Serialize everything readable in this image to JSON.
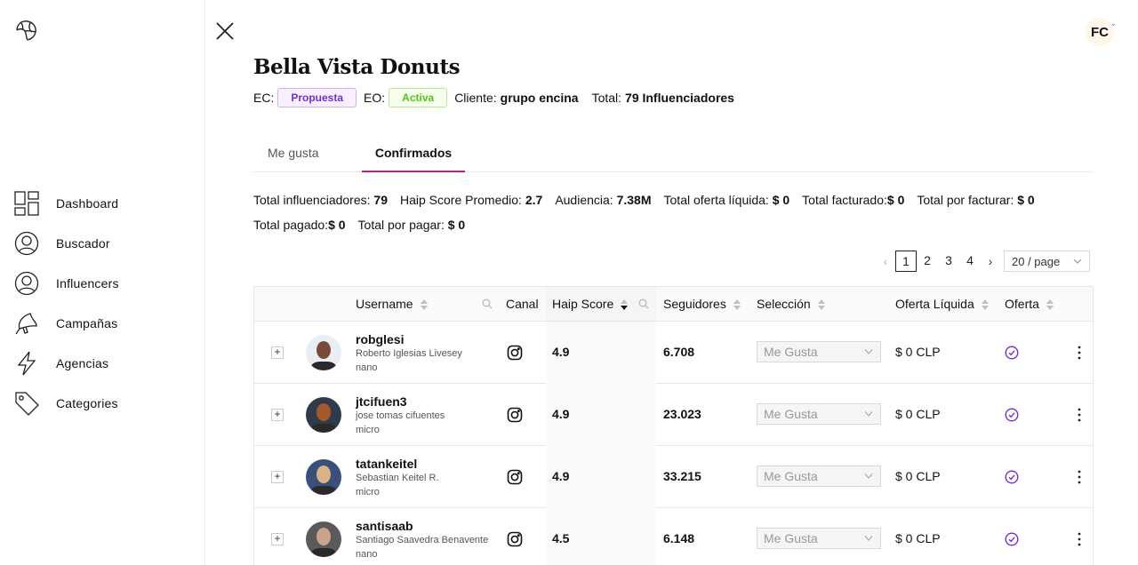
{
  "nav": {
    "items": [
      {
        "label": "Dashboard",
        "icon": "dashboard-icon"
      },
      {
        "label": "Buscador",
        "icon": "user-circle-icon"
      },
      {
        "label": "Influencers",
        "icon": "user-circle-icon"
      },
      {
        "label": "Campañas",
        "icon": "megaphone-icon"
      },
      {
        "label": "Agencias",
        "icon": "lightning-icon"
      },
      {
        "label": "Categories",
        "icon": "tag-icon"
      }
    ]
  },
  "user": {
    "initials": "FC"
  },
  "campaign": {
    "title": "Bella Vista Donuts",
    "ec_label": "EC:",
    "ec_status": "Propuesta",
    "eo_label": "EO:",
    "eo_status": "Activa",
    "client_label": "Cliente:",
    "client": "grupo encina",
    "total_label": "Total:",
    "total": "79 Influenciadores"
  },
  "tabs": [
    {
      "label": "Me gusta",
      "active": false
    },
    {
      "label": "Confirmados",
      "active": true
    }
  ],
  "stats": [
    {
      "label": "Total influenciadores: ",
      "value": "79"
    },
    {
      "label": "Haip Score Promedio: ",
      "value": "2.7"
    },
    {
      "label": "Audiencia: ",
      "value": "7.38M"
    },
    {
      "label": "Total oferta líquida: ",
      "value": "$ 0"
    },
    {
      "label": "Total facturado:",
      "value": "$ 0"
    },
    {
      "label": "Total por facturar: ",
      "value": "$ 0"
    },
    {
      "label": "Total pagado:",
      "value": "$ 0"
    },
    {
      "label": "Total por pagar: ",
      "value": "$ 0"
    }
  ],
  "pagination": {
    "pages": [
      "1",
      "2",
      "3",
      "4"
    ],
    "current": "1",
    "page_size": "20 / page"
  },
  "table": {
    "headers": {
      "username": "Username",
      "canal": "Canal",
      "haip": "Haip Score",
      "seguidores": "Seguidores",
      "seleccion": "Selección",
      "oferta_liquida": "Oferta Líquida",
      "oferta": "Oferta"
    },
    "rows": [
      {
        "username": "robglesi",
        "fullname": "Roberto Iglesias Livesey",
        "tier": "nano",
        "score": "4.9",
        "followers": "6.708",
        "selection": "Me Gusta",
        "offer": "$ 0 CLP",
        "accent": "#7a4b3a",
        "bg": "#e9eef3"
      },
      {
        "username": "jtcifuen3",
        "fullname": "jose tomas cifuentes",
        "tier": "micro",
        "score": "4.9",
        "followers": "23.023",
        "selection": "Me Gusta",
        "offer": "$ 0 CLP",
        "accent": "#a35a2a",
        "bg": "#2f3b4a"
      },
      {
        "username": "tatankeitel",
        "fullname": "Sebastian Keitel R.",
        "tier": "micro",
        "score": "4.9",
        "followers": "33.215",
        "selection": "Me Gusta",
        "offer": "$ 0 CLP",
        "accent": "#d9b48a",
        "bg": "#3a4f7a"
      },
      {
        "username": "santisaab",
        "fullname": "Santiago Saavedra Benavente",
        "tier": "nano",
        "score": "4.5",
        "followers": "6.148",
        "selection": "Me Gusta",
        "offer": "$ 0 CLP",
        "accent": "#c9a48a",
        "bg": "#5a5a5a"
      }
    ]
  },
  "colors": {
    "active_tab": "#c41d7f",
    "check": "#722ed1"
  }
}
